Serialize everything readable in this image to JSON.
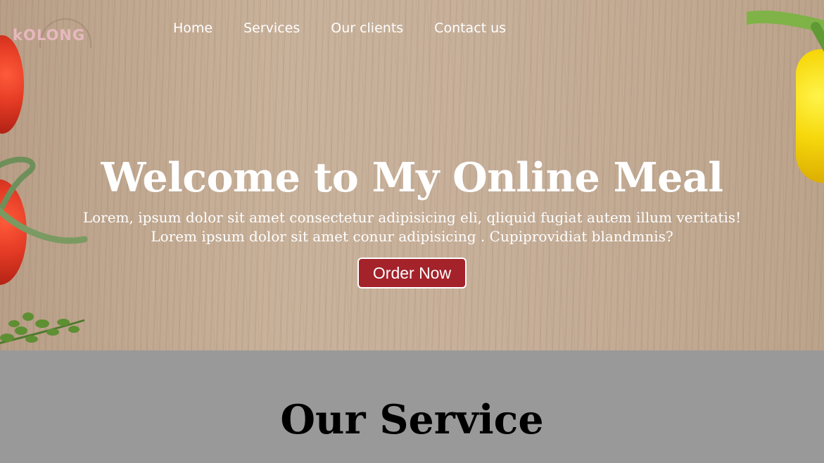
{
  "brand": {
    "logo_text": "kOLONG",
    "accent_color": "#e6b8be"
  },
  "nav": {
    "items": [
      {
        "label": "Home"
      },
      {
        "label": "Services"
      },
      {
        "label": "Our clients"
      },
      {
        "label": "Contact us"
      }
    ]
  },
  "hero": {
    "title": "Welcome to My Online Meal",
    "description_line1": "Lorem, ipsum dolor sit amet consectetur adipisicing eli, qliquid fugiat autem illum veritatis!",
    "description_line2": "Lorem ipsum dolor sit amet conur adipisicing . Cupiprovidiat blandmnis?",
    "cta_label": "Order Now",
    "cta_color": "#a4222a"
  },
  "services": {
    "title": "Our Service",
    "background": "#999999"
  }
}
